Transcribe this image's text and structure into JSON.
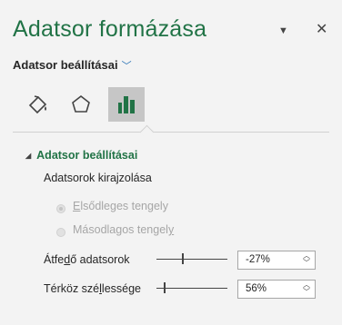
{
  "pane": {
    "title": "Adatsor formázása",
    "dropdown_icon": "triangle-down-icon",
    "close_icon": "close-icon"
  },
  "options_menu": {
    "label": "Adatsor beállításai"
  },
  "icon_tabs": [
    {
      "name": "fill-line-icon"
    },
    {
      "name": "effects-pentagon-icon"
    },
    {
      "name": "series-options-bar-chart-icon",
      "selected": true
    }
  ],
  "section": {
    "title": "Adatsor beállításai",
    "plot_label": "Adatsorok kirajzolása",
    "radio_primary": {
      "pre": "",
      "key": "E",
      "post": "lsődleges tengely",
      "checked": true
    },
    "radio_secondary": {
      "pre": "Másodlagos tengel",
      "key": "y",
      "post": "",
      "checked": false
    },
    "overlap": {
      "pre": "Átfe",
      "key": "d",
      "post": "ő adatsorok",
      "value": "-27%",
      "level": -27
    },
    "gap": {
      "pre": "Térköz szé",
      "key": "l",
      "post": "lessége",
      "value": "56%",
      "level": 56
    }
  },
  "colors": {
    "accent": "#217346",
    "link": "#2e75b6"
  }
}
